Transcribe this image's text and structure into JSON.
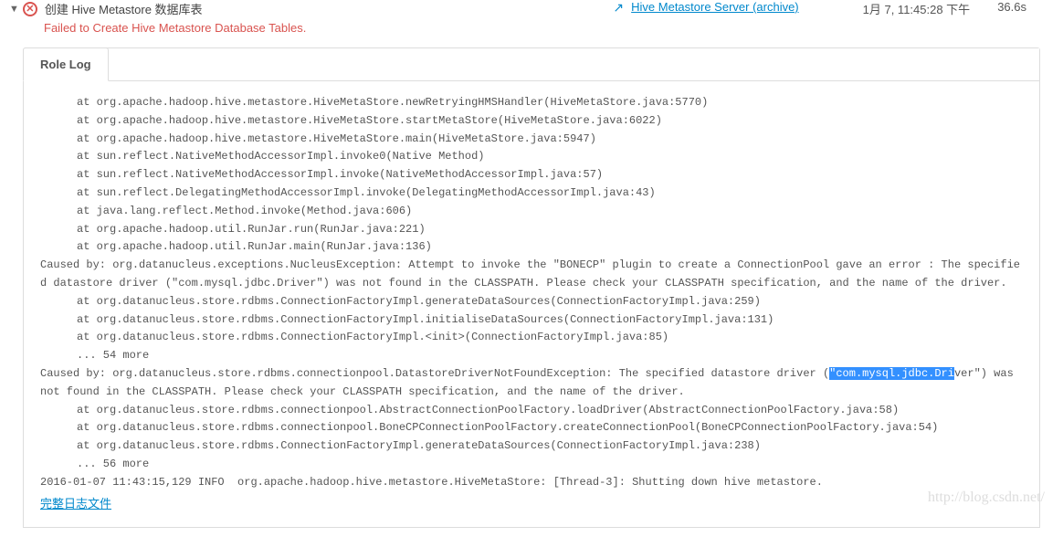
{
  "header": {
    "title": "创建 Hive Metastore 数据库表",
    "error_message": "Failed to Create Hive Metastore Database Tables.",
    "server_link": "Hive Metastore Server (archive)",
    "timestamp": "1月 7, 11:45:28 下午",
    "duration": "36.6s"
  },
  "tab": {
    "label": "Role Log"
  },
  "log": {
    "l0": "at org.apache.hadoop.hive.metastore.HiveMetaStore.newRetryingHMSHandler(HiveMetaStore.java:5770)",
    "l1": "at org.apache.hadoop.hive.metastore.HiveMetaStore.startMetaStore(HiveMetaStore.java:6022)",
    "l2": "at org.apache.hadoop.hive.metastore.HiveMetaStore.main(HiveMetaStore.java:5947)",
    "l3": "at sun.reflect.NativeMethodAccessorImpl.invoke0(Native Method)",
    "l4": "at sun.reflect.NativeMethodAccessorImpl.invoke(NativeMethodAccessorImpl.java:57)",
    "l5": "at sun.reflect.DelegatingMethodAccessorImpl.invoke(DelegatingMethodAccessorImpl.java:43)",
    "l6": "at java.lang.reflect.Method.invoke(Method.java:606)",
    "l7": "at org.apache.hadoop.util.RunJar.run(RunJar.java:221)",
    "l8": "at org.apache.hadoop.util.RunJar.main(RunJar.java:136)",
    "c1": "Caused by: org.datanucleus.exceptions.NucleusException: Attempt to invoke the \"BONECP\" plugin to create a ConnectionPool gave an error : The specified datastore driver (\"com.mysql.jdbc.Driver\") was not found in the CLASSPATH. Please check your CLASSPATH specification, and the name of the driver.",
    "l9": "at org.datanucleus.store.rdbms.ConnectionFactoryImpl.generateDataSources(ConnectionFactoryImpl.java:259)",
    "l10": "at org.datanucleus.store.rdbms.ConnectionFactoryImpl.initialiseDataSources(ConnectionFactoryImpl.java:131)",
    "l11": "at org.datanucleus.store.rdbms.ConnectionFactoryImpl.<init>(ConnectionFactoryImpl.java:85)",
    "l12": "... 54 more",
    "c2a": "Caused by: org.datanucleus.store.rdbms.connectionpool.DatastoreDriverNotFoundException: The specified datastore driver (",
    "c2h": "\"com.mysql.jdbc.Dri",
    "c2b": "ver\") was not found in the CLASSPATH. Please check your CLASSPATH specification, and the name of the driver.",
    "l13": "at org.datanucleus.store.rdbms.connectionpool.AbstractConnectionPoolFactory.loadDriver(AbstractConnectionPoolFactory.java:58)",
    "l14": "at org.datanucleus.store.rdbms.connectionpool.BoneCPConnectionPoolFactory.createConnectionPool(BoneCPConnectionPoolFactory.java:54)",
    "l15": "at org.datanucleus.store.rdbms.ConnectionFactoryImpl.generateDataSources(ConnectionFactoryImpl.java:238)",
    "l16": "... 56 more",
    "f1": "2016-01-07 11:43:15,129 INFO  org.apache.hadoop.hive.metastore.HiveMetaStore: [Thread-3]: Shutting down hive metastore.",
    "full_log": "完整日志文件"
  },
  "watermark": "http://blog.csdn.net/"
}
